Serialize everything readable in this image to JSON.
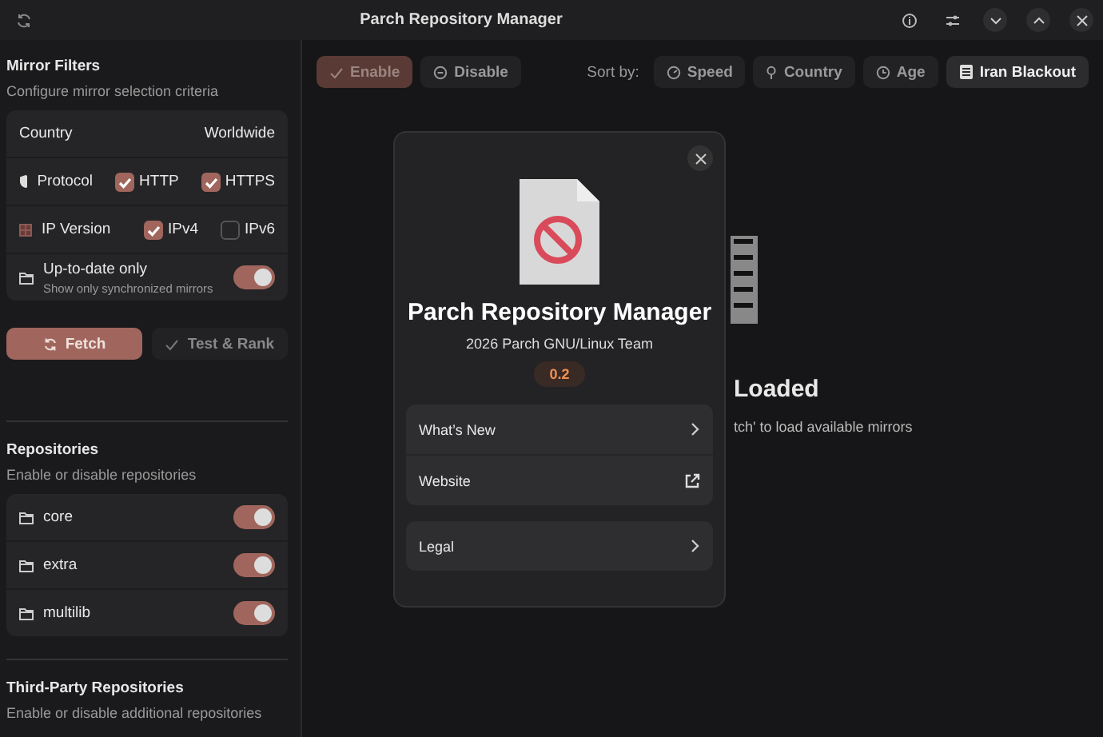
{
  "window": {
    "title": "Parch Repository Manager"
  },
  "sidebar": {
    "mirror_filters": {
      "title": "Mirror Filters",
      "subtitle": "Configure mirror selection criteria",
      "country": {
        "label": "Country",
        "value": "Worldwide"
      },
      "protocol": {
        "label": "Protocol",
        "options": [
          {
            "label": "HTTP",
            "checked": true
          },
          {
            "label": "HTTPS",
            "checked": true
          }
        ]
      },
      "ip_version": {
        "label": "IP Version",
        "options": [
          {
            "label": "IPv4",
            "checked": true
          },
          {
            "label": "IPv6",
            "checked": false
          }
        ]
      },
      "up_to_date": {
        "label": "Up-to-date only",
        "description": "Show only synchronized mirrors",
        "on": true
      }
    },
    "actions": [
      {
        "label": "Fetch",
        "kind": "primary"
      },
      {
        "label": "Test & Rank",
        "kind": "secondary"
      }
    ],
    "repositories": {
      "title": "Repositories",
      "subtitle": "Enable or disable repositories",
      "items": [
        {
          "name": "core",
          "on": true
        },
        {
          "name": "extra",
          "on": true
        },
        {
          "name": "multilib",
          "on": true
        }
      ]
    },
    "third_party": {
      "title": "Third-Party Repositories",
      "subtitle": "Enable or disable additional repositories"
    }
  },
  "toolbar": {
    "actions": [
      {
        "label": "Enable",
        "kind": "enable"
      },
      {
        "label": "Disable",
        "kind": "disable"
      }
    ],
    "sort_label": "Sort by:",
    "sort_options": [
      {
        "label": "Speed",
        "kind": "speed",
        "selected": false
      },
      {
        "label": "Country",
        "kind": "country",
        "selected": false
      },
      {
        "label": "Age",
        "kind": "age",
        "selected": false
      },
      {
        "label": "Iran Blackout",
        "kind": "blackout",
        "selected": true
      }
    ]
  },
  "empty_state": {
    "title": "Loaded",
    "message": "tch' to load available mirrors"
  },
  "about_dialog": {
    "app_name": "Parch Repository Manager",
    "credits": "2026 Parch GNU/Linux Team",
    "version": "0.2",
    "groups": [
      [
        {
          "label": "What’s New",
          "kind": "page"
        },
        {
          "label": "Website",
          "kind": "external"
        }
      ],
      [
        {
          "label": "Legal",
          "kind": "page"
        }
      ]
    ]
  }
}
